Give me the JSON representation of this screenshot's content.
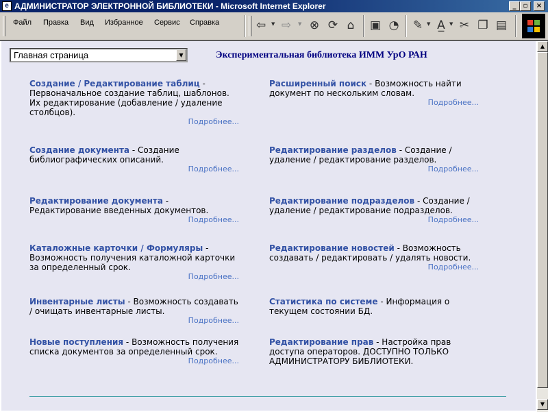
{
  "window": {
    "title": "АДМИНИСТРАТОР ЭЛЕКТРОННОЙ БИБЛИОТЕКИ - Microsoft Internet Explorer",
    "minimize": "_",
    "maximize": "▫",
    "close": "×"
  },
  "menu": [
    "Файл",
    "Правка",
    "Вид",
    "Избранное",
    "Сервис",
    "Справка"
  ],
  "toolbar_icons": [
    "back-icon",
    "forward-icon",
    "stop-icon",
    "refresh-icon",
    "home-icon",
    "media-icon",
    "history-icon",
    "edit-icon",
    "translate-icon",
    "cut-icon",
    "copy-icon",
    "paste-icon",
    "windows-logo-icon"
  ],
  "page": {
    "nav_select_value": "Главная страница",
    "site_title": "Экспериментальная библиотека ИММ УрО РАН",
    "more_label": "Подробнее...",
    "left_items": [
      {
        "name": "Создание / Редактирование таблиц",
        "desc": " - Первоначальное создание таблиц, шаблонов. Их редактирование (добавление / удаление столбцов)."
      },
      {
        "name": "Создание документа",
        "desc": " - Создание библиографических описаний."
      },
      {
        "name": "Редактирование документа",
        "desc": " - Редактирование введенных документов."
      },
      {
        "name": "Каталожные карточки / Формуляры",
        "desc": " - Возможность получения каталожной карточки за определенный срок."
      },
      {
        "name": "Инвентарные листы",
        "desc": " - Возможность создавать / очищать инвентарные листы."
      },
      {
        "name": "Новые поступления",
        "desc": " - Возможность получения списка документов за определенный срок."
      }
    ],
    "right_items": [
      {
        "name": "Расширенный поиск",
        "desc": " - Возможность найти документ по нескольким словам."
      },
      {
        "name": "Редактирование разделов",
        "desc": " - Создание / удаление / редактирование разделов."
      },
      {
        "name": "Редактирование подразделов",
        "desc": " - Создание / удаление / редактирование подразделов."
      },
      {
        "name": "Редактирование новостей",
        "desc": " - Возможность создавать / редактировать / удалять новости."
      },
      {
        "name": "Статистика по системе",
        "desc": " - Информация о текущем состоянии БД."
      },
      {
        "name": "Редактирование прав",
        "desc": " - Настройка прав доступа операторов. ДОСТУПНО ТОЛЬКО АДМИНИСТРАТОРУ БИБЛИОТЕКИ."
      }
    ]
  },
  "colors": {
    "titlebar": "#0a246a",
    "page_background": "#e6e6f2",
    "link_blue": "#3352a5",
    "site_title": "#000080",
    "divider": "#3f9fa6"
  }
}
